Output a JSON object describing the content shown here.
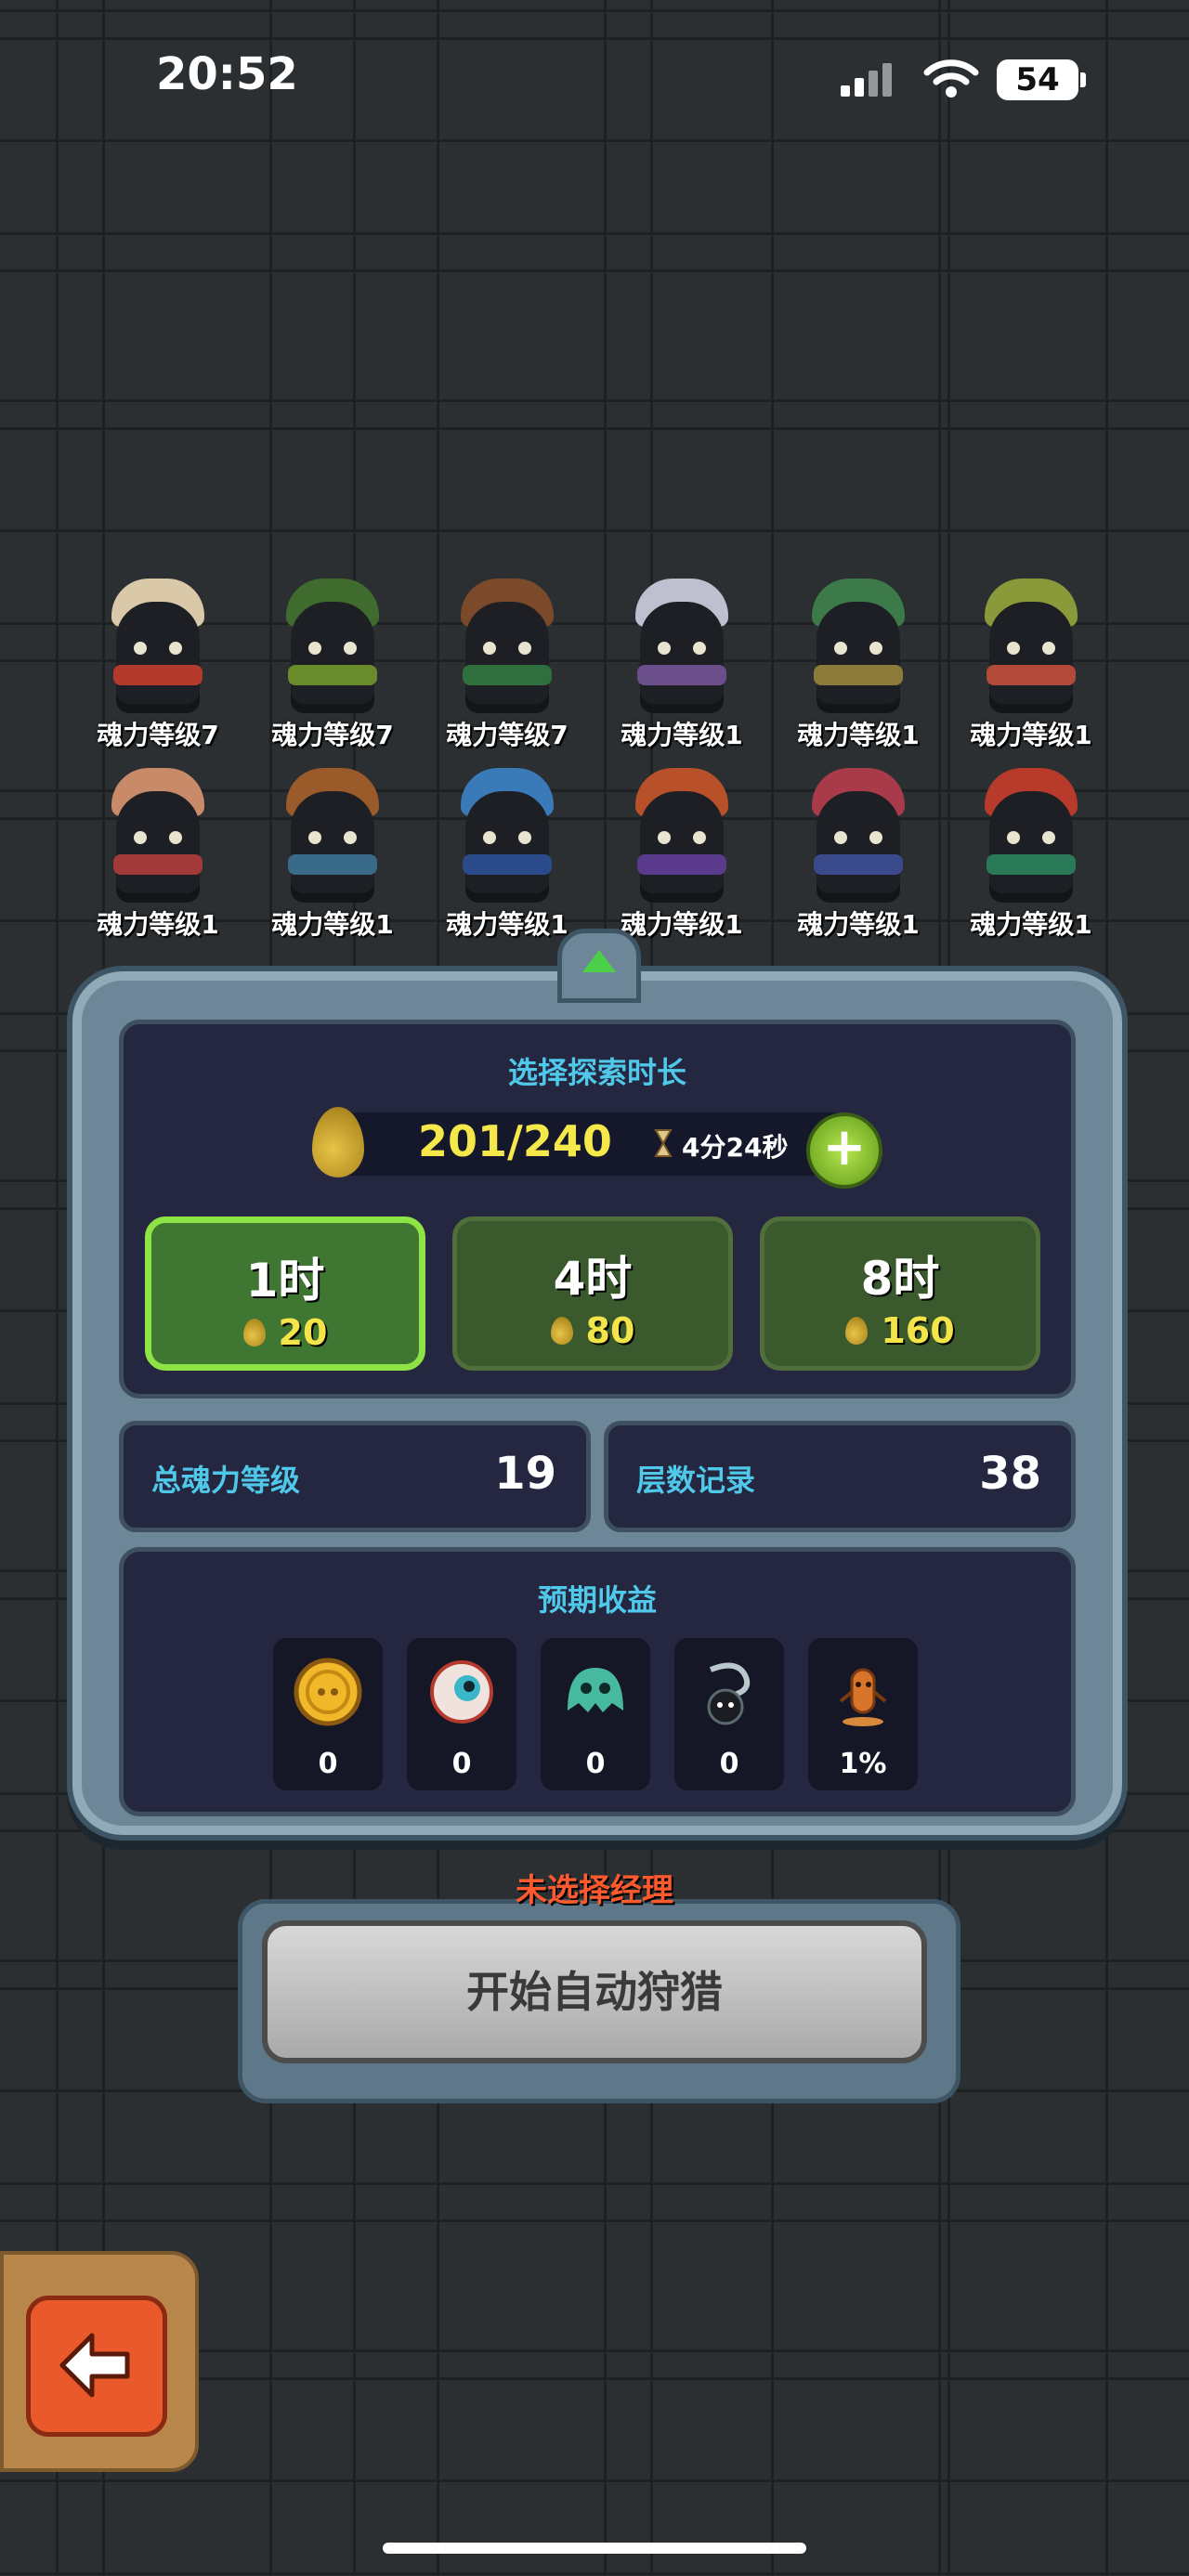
{
  "status_bar": {
    "time": "20:52",
    "battery": "54"
  },
  "roster": [
    {
      "label": "魂力等级7",
      "hat": "#d9c9a8",
      "scarf": "#b33a2d"
    },
    {
      "label": "魂力等级7",
      "hat": "#3f6b2f",
      "scarf": "#6a8b2c"
    },
    {
      "label": "魂力等级7",
      "hat": "#7a4a2b",
      "scarf": "#2f6e3d"
    },
    {
      "label": "魂力等级1",
      "hat": "#bfbfcf",
      "scarf": "#6a4f8b"
    },
    {
      "label": "魂力等级1",
      "hat": "#3c7a4a",
      "scarf": "#8b7a3a"
    },
    {
      "label": "魂力等级1",
      "hat": "#8a9a3a",
      "scarf": "#b24a3a"
    },
    {
      "label": "魂力等级1",
      "hat": "#c98a6a",
      "scarf": "#a23a3a"
    },
    {
      "label": "魂力等级1",
      "hat": "#9a5a2a",
      "scarf": "#3a6a8a"
    },
    {
      "label": "魂力等级1",
      "hat": "#3a7ab8",
      "scarf": "#2a4a8a"
    },
    {
      "label": "魂力等级1",
      "hat": "#b8502a",
      "scarf": "#5a3a8a"
    },
    {
      "label": "魂力等级1",
      "hat": "#a83a4a",
      "scarf": "#3a4a8a"
    },
    {
      "label": "魂力等级1",
      "hat": "#b83a2a",
      "scarf": "#2a7a5a"
    }
  ],
  "panel": {
    "title": "选择探索时长",
    "energy": "201/240",
    "timer": "4分24秒",
    "durations": [
      {
        "label": "1时",
        "cost": "20",
        "selected": true
      },
      {
        "label": "4时",
        "cost": "80",
        "selected": false
      },
      {
        "label": "8时",
        "cost": "160",
        "selected": false
      }
    ],
    "stats": {
      "total_label": "总魂力等级",
      "total_value": "19",
      "floor_label": "层数记录",
      "floor_value": "38"
    },
    "rewards_title": "预期收益",
    "rewards": [
      {
        "icon": "gold-coin-icon",
        "value": "0"
      },
      {
        "icon": "eyeball-icon",
        "value": "0"
      },
      {
        "icon": "ghost-spirit-icon",
        "value": "0"
      },
      {
        "icon": "snake-pet-icon",
        "value": "0"
      },
      {
        "icon": "figure-statue-icon",
        "value": "1%"
      }
    ]
  },
  "manager_warning": "未选择经理",
  "start_button": "开始自动狩猎",
  "colors": {
    "accent_cyan": "#4fc8ea",
    "gold": "#f3e44a",
    "selected_green": "#8ee345",
    "warning": "#ff5a2e"
  }
}
